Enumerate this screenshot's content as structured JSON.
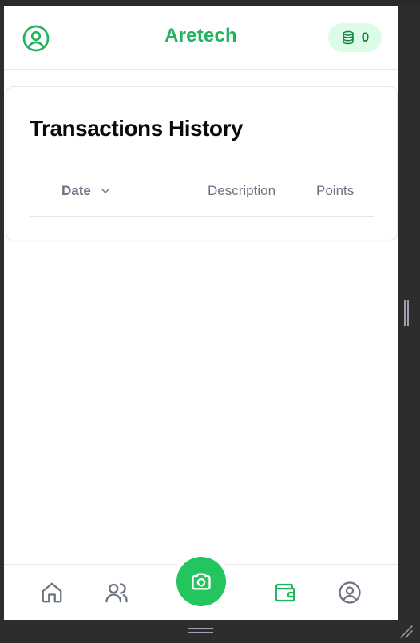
{
  "header": {
    "brand": "Aretech",
    "points_count": "0",
    "profile_icon": "user-circle-icon",
    "points_icon": "coins-icon"
  },
  "card": {
    "title": "Transactions History",
    "columns": [
      {
        "label": "Date",
        "sortable": true,
        "sort_icon": "chevron-down-icon"
      },
      {
        "label": "Description"
      },
      {
        "label": "Points"
      }
    ],
    "rows": []
  },
  "bottom_nav": {
    "items": [
      {
        "id": "home",
        "icon": "home-icon",
        "active": false
      },
      {
        "id": "friends",
        "icon": "users-icon",
        "active": false
      },
      {
        "id": "scan",
        "icon": "camera-icon",
        "active": false
      },
      {
        "id": "wallet",
        "icon": "wallet-icon",
        "active": true
      },
      {
        "id": "profile",
        "icon": "user-circle-icon",
        "active": false
      }
    ]
  },
  "colors": {
    "brand_green": "#22b35e",
    "pill_bg": "#dcfce7",
    "pill_text": "#15803d",
    "camera_bg": "#22c55e",
    "inactive_icon": "#6b7280",
    "title_text": "#0a0a0a"
  }
}
